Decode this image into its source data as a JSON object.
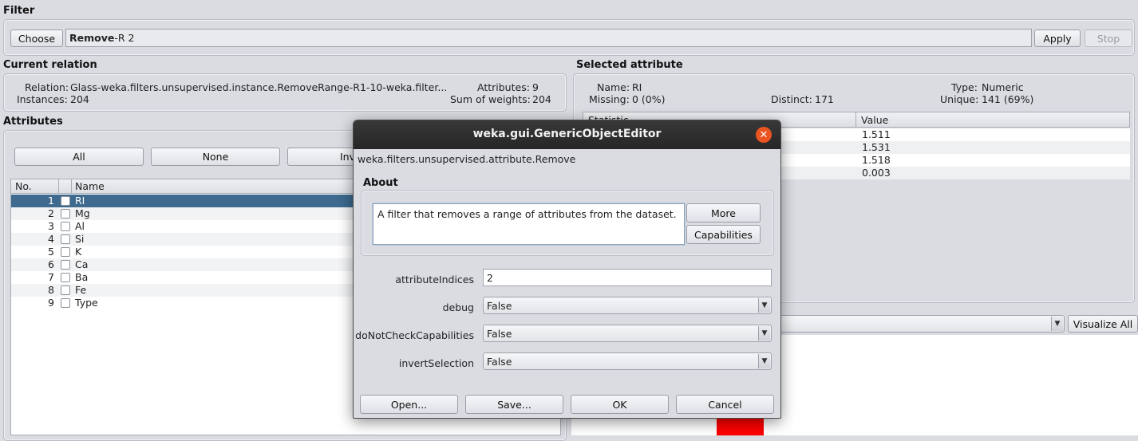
{
  "filter": {
    "title": "Filter",
    "choose_label": "Choose",
    "filter_name": "Remove",
    "filter_args": " -R 2",
    "apply_label": "Apply",
    "stop_label": "Stop"
  },
  "current_relation": {
    "title": "Current relation",
    "relation_label": "Relation:",
    "relation_value": "Glass-weka.filters.unsupervised.instance.RemoveRange-R1-10-weka.filter...",
    "instances_label": "Instances:",
    "instances_value": "204",
    "attributes_label": "Attributes:",
    "attributes_value": "9",
    "sum_weights_label": "Sum of weights:",
    "sum_weights_value": "204"
  },
  "attributes": {
    "title": "Attributes",
    "all_label": "All",
    "none_label": "None",
    "invert_label": "Inv",
    "col_no": "No.",
    "col_name": "Name",
    "rows": [
      {
        "no": "1",
        "name": "RI",
        "selected": true
      },
      {
        "no": "2",
        "name": "Mg",
        "selected": false
      },
      {
        "no": "3",
        "name": "Al",
        "selected": false
      },
      {
        "no": "4",
        "name": "Si",
        "selected": false
      },
      {
        "no": "5",
        "name": "K",
        "selected": false
      },
      {
        "no": "6",
        "name": "Ca",
        "selected": false
      },
      {
        "no": "7",
        "name": "Ba",
        "selected": false
      },
      {
        "no": "8",
        "name": "Fe",
        "selected": false
      },
      {
        "no": "9",
        "name": "Type",
        "selected": false
      }
    ]
  },
  "selected_attribute": {
    "title": "Selected attribute",
    "name_label": "Name:",
    "name_value": "RI",
    "type_label": "Type:",
    "type_value": "Numeric",
    "missing_label": "Missing:",
    "missing_value": "0 (0%)",
    "distinct_label": "Distinct:",
    "distinct_value": "171",
    "unique_label": "Unique:",
    "unique_value": "141 (69%)",
    "col_statistic": "Statistic",
    "col_value": "Value",
    "values": [
      "1.511",
      "1.531",
      "1.518",
      "0.003"
    ],
    "visualize_all_label": "Visualize All"
  },
  "dialog": {
    "title": "weka.gui.GenericObjectEditor",
    "class_name": "weka.filters.unsupervised.attribute.Remove",
    "about_title": "About",
    "about_text": "A filter that removes a range of attributes from the dataset.",
    "more_label": "More",
    "capabilities_label": "Capabilities",
    "props": [
      {
        "label": "attributeIndices",
        "value": "2",
        "kind": "text"
      },
      {
        "label": "debug",
        "value": "False",
        "kind": "combo"
      },
      {
        "label": "doNotCheckCapabilities",
        "value": "False",
        "kind": "combo"
      },
      {
        "label": "invertSelection",
        "value": "False",
        "kind": "combo"
      }
    ],
    "open_label": "Open...",
    "save_label": "Save...",
    "ok_label": "OK",
    "cancel_label": "Cancel"
  },
  "colors": {
    "selection": "#3d6a8e",
    "titlebar": "#2c2c2c",
    "close": "#e95420",
    "bar": "#ff0000"
  }
}
